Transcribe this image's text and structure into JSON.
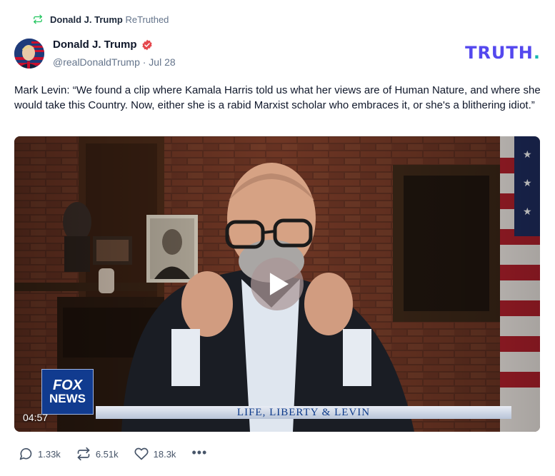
{
  "retruth": {
    "name": "Donald J. Trump",
    "label": "ReTruthed"
  },
  "author": {
    "name": "Donald J. Trump",
    "handle": "@realDonaldTrump · Jul 28"
  },
  "brand": {
    "word": "TRUTH",
    "dot": "."
  },
  "post": {
    "text": "Mark Levin: “We found a clip where Kamala Harris told us what her views are of Human Nature, and where she would take this Country. Now, either she is a rabid Marxist scholar who embraces it, or she's a blithering idiot.”"
  },
  "video": {
    "duration": "04:57",
    "banner_text": "LIFE, LIBERTY & LEVIN",
    "network_logo": {
      "line1": "FOX",
      "line2": "NEWS"
    }
  },
  "actions": {
    "replies": "1.33k",
    "retruths": "6.51k",
    "likes": "18.3k",
    "more": "•••"
  },
  "colors": {
    "brand": "#5448ee",
    "brand_dot": "#17b8b0",
    "retruth_icon": "#22c55e",
    "verified": "#e5484d"
  },
  "icons": {
    "retruth": "retruth-icon",
    "verified": "verified-badge-icon",
    "play": "play-icon",
    "reply": "reply-icon",
    "like": "heart-icon",
    "more": "more-icon"
  }
}
